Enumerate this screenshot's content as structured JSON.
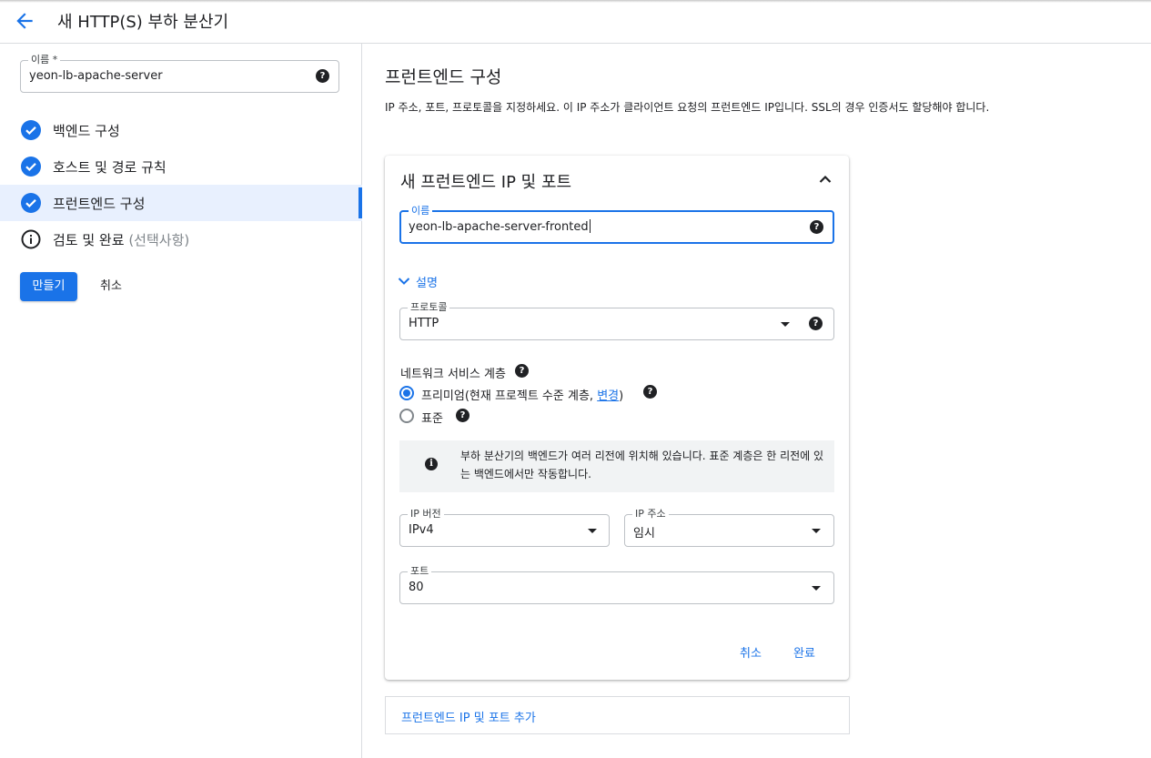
{
  "header": {
    "title": "새 HTTP(S) 부하 분산기"
  },
  "sidebar": {
    "name_field": {
      "label": "이름 *",
      "value": "yeon-lb-apache-server"
    },
    "steps": [
      {
        "label": "백엔드 구성",
        "status": "done"
      },
      {
        "label": "호스트 및 경로 규칙",
        "status": "done"
      },
      {
        "label": "프런트엔드 구성",
        "status": "done",
        "active": true
      },
      {
        "label": "검토 및 완료",
        "optional": "(선택사항)",
        "status": "info"
      }
    ],
    "create_label": "만들기",
    "cancel_label": "취소"
  },
  "main": {
    "title": "프런트엔드 구성",
    "description": "IP 주소, 포트, 프로토콜을 지정하세요. 이 IP 주소가 클라이언트 요청의 프런트엔드 IP입니다. SSL의 경우 인증서도 할당해야 합니다.",
    "card": {
      "title": "새 프런트엔드 IP 및 포트",
      "name_field": {
        "label": "이름",
        "value": "yeon-lb-apache-server-fronted"
      },
      "description_toggle": "설명",
      "protocol": {
        "label": "프로토콜",
        "value": "HTTP"
      },
      "network_tier": {
        "label": "네트워크 서비스 계층",
        "premium_label": "프리미엄(현재 프로젝트 수준 계층, ",
        "premium_link": "변경",
        "premium_suffix": ")",
        "standard_label": "표준",
        "selected": "premium"
      },
      "info_text": "부하 분산기의 백엔드가 여러 리전에 위치해 있습니다. 표준 계층은 한 리전에 있는 백엔드에서만 작동합니다.",
      "ip_version": {
        "label": "IP 버전",
        "value": "IPv4"
      },
      "ip_address": {
        "label": "IP 주소",
        "value": "임시"
      },
      "port": {
        "label": "포트",
        "value": "80"
      },
      "cancel_label": "취소",
      "done_label": "완료"
    },
    "add_label": "프런트엔드 IP 및 포트 추가"
  },
  "colors": {
    "accent": "#1a73e8",
    "active_step_bg": "#e8f0fe",
    "info_bg": "#f1f3f4"
  }
}
